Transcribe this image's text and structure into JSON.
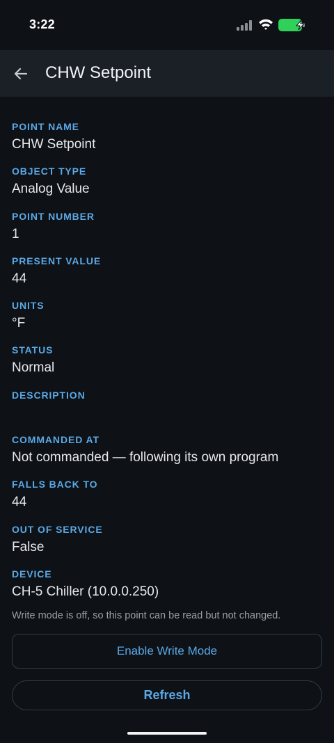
{
  "status_bar": {
    "time": "3:22",
    "battery_color": "#30d158"
  },
  "header": {
    "title": "CHW Setpoint"
  },
  "fields": [
    {
      "label": "POINT NAME",
      "value": "CHW Setpoint"
    },
    {
      "label": "OBJECT TYPE",
      "value": "Analog Value"
    },
    {
      "label": "POINT NUMBER",
      "value": "1"
    },
    {
      "label": "PRESENT VALUE",
      "value": "44"
    },
    {
      "label": "UNITS",
      "value": "°F"
    },
    {
      "label": "STATUS",
      "value": "Normal"
    },
    {
      "label": "DESCRIPTION",
      "value": ""
    },
    {
      "label": "COMMANDED AT",
      "value": "Not commanded — following its own program"
    },
    {
      "label": "FALLS BACK TO",
      "value": "44"
    },
    {
      "label": "OUT OF SERVICE",
      "value": "False"
    },
    {
      "label": "DEVICE",
      "value": "CH-5 Chiller (10.0.0.250)"
    }
  ],
  "note": "Write mode is off, so this point can be read but not changed.",
  "actions": {
    "enable_write_label": "Enable Write Mode",
    "refresh_label": "Refresh"
  },
  "colors": {
    "accent": "#5aa9e6",
    "background": "#0e1116",
    "app_bar": "#1b1f26"
  }
}
